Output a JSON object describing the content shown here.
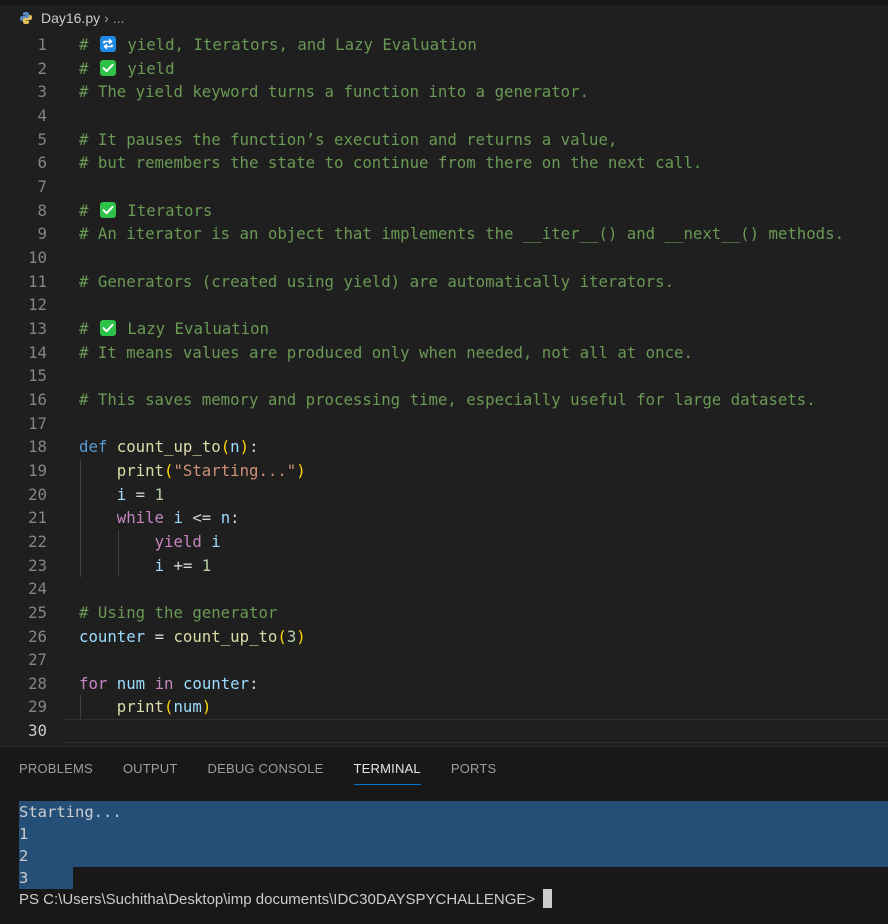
{
  "breadcrumb": {
    "file": "Day16.py",
    "separator": "›",
    "more": "..."
  },
  "editor": {
    "current_line": 30,
    "lines": [
      {
        "n": "1",
        "tokens": [
          [
            "cm",
            "# "
          ],
          [
            "emoji",
            "repeat"
          ],
          [
            "cm",
            " yield, Iterators, and Lazy Evaluation"
          ]
        ]
      },
      {
        "n": "2",
        "tokens": [
          [
            "cm",
            "# "
          ],
          [
            "emoji",
            "check"
          ],
          [
            "cm",
            " yield"
          ]
        ]
      },
      {
        "n": "3",
        "tokens": [
          [
            "cm",
            "# The yield keyword turns a function into a generator."
          ]
        ]
      },
      {
        "n": "4",
        "tokens": []
      },
      {
        "n": "5",
        "tokens": [
          [
            "cm",
            "# It pauses the function’s execution and returns a value,"
          ]
        ]
      },
      {
        "n": "6",
        "tokens": [
          [
            "cm",
            "# but remembers the state to continue from there on the next call."
          ]
        ]
      },
      {
        "n": "7",
        "tokens": []
      },
      {
        "n": "8",
        "tokens": [
          [
            "cm",
            "# "
          ],
          [
            "emoji",
            "check"
          ],
          [
            "cm",
            " Iterators"
          ]
        ]
      },
      {
        "n": "9",
        "tokens": [
          [
            "cm",
            "# An iterator is an object that implements the __iter__() and __next__() methods."
          ]
        ]
      },
      {
        "n": "10",
        "tokens": []
      },
      {
        "n": "11",
        "tokens": [
          [
            "cm",
            "# Generators (created using yield) are automatically iterators."
          ]
        ]
      },
      {
        "n": "12",
        "tokens": []
      },
      {
        "n": "13",
        "tokens": [
          [
            "cm",
            "# "
          ],
          [
            "emoji",
            "check"
          ],
          [
            "cm",
            " Lazy Evaluation"
          ]
        ]
      },
      {
        "n": "14",
        "tokens": [
          [
            "cm",
            "# It means values are produced only when needed, not all at once."
          ]
        ]
      },
      {
        "n": "15",
        "tokens": []
      },
      {
        "n": "16",
        "tokens": [
          [
            "cm",
            "# This saves memory and processing time, especially useful for large datasets."
          ]
        ]
      },
      {
        "n": "17",
        "tokens": []
      },
      {
        "n": "18",
        "tokens": [
          [
            "kw",
            "def"
          ],
          [
            "op",
            " "
          ],
          [
            "fn",
            "count_up_to"
          ],
          [
            "br1",
            "("
          ],
          [
            "var",
            "n"
          ],
          [
            "br1",
            ")"
          ],
          [
            "op",
            ":"
          ]
        ]
      },
      {
        "n": "19",
        "tokens": [
          [
            "op",
            "    "
          ],
          [
            "fn",
            "print"
          ],
          [
            "br1",
            "("
          ],
          [
            "str",
            "\"Starting...\""
          ],
          [
            "br1",
            ")"
          ]
        ]
      },
      {
        "n": "20",
        "tokens": [
          [
            "op",
            "    "
          ],
          [
            "var",
            "i"
          ],
          [
            "op",
            " = "
          ],
          [
            "num",
            "1"
          ]
        ]
      },
      {
        "n": "21",
        "tokens": [
          [
            "op",
            "    "
          ],
          [
            "ctl",
            "while"
          ],
          [
            "op",
            " "
          ],
          [
            "var",
            "i"
          ],
          [
            "op",
            " <= "
          ],
          [
            "var",
            "n"
          ],
          [
            "op",
            ":"
          ]
        ]
      },
      {
        "n": "22",
        "tokens": [
          [
            "op",
            "        "
          ],
          [
            "ctl",
            "yield"
          ],
          [
            "op",
            " "
          ],
          [
            "var",
            "i"
          ]
        ]
      },
      {
        "n": "23",
        "tokens": [
          [
            "op",
            "        "
          ],
          [
            "var",
            "i"
          ],
          [
            "op",
            " += "
          ],
          [
            "num",
            "1"
          ]
        ]
      },
      {
        "n": "24",
        "tokens": []
      },
      {
        "n": "25",
        "tokens": [
          [
            "cm",
            "# Using the generator"
          ]
        ]
      },
      {
        "n": "26",
        "tokens": [
          [
            "var",
            "counter"
          ],
          [
            "op",
            " = "
          ],
          [
            "fn",
            "count_up_to"
          ],
          [
            "br1",
            "("
          ],
          [
            "num",
            "3"
          ],
          [
            "br1",
            ")"
          ]
        ]
      },
      {
        "n": "27",
        "tokens": []
      },
      {
        "n": "28",
        "tokens": [
          [
            "ctl",
            "for"
          ],
          [
            "op",
            " "
          ],
          [
            "var",
            "num"
          ],
          [
            "op",
            " "
          ],
          [
            "ctl",
            "in"
          ],
          [
            "op",
            " "
          ],
          [
            "var",
            "counter"
          ],
          [
            "op",
            ":"
          ]
        ]
      },
      {
        "n": "29",
        "tokens": [
          [
            "op",
            "    "
          ],
          [
            "fn",
            "print"
          ],
          [
            "br1",
            "("
          ],
          [
            "var",
            "num"
          ],
          [
            "br1",
            ")"
          ]
        ]
      },
      {
        "n": "30",
        "tokens": []
      }
    ]
  },
  "panel": {
    "tabs": [
      {
        "label": "PROBLEMS",
        "active": false
      },
      {
        "label": "OUTPUT",
        "active": false
      },
      {
        "label": "DEBUG CONSOLE",
        "active": false
      },
      {
        "label": "TERMINAL",
        "active": true
      },
      {
        "label": "PORTS",
        "active": false
      }
    ],
    "terminal": {
      "output": [
        "Starting...",
        "1",
        "2",
        "3"
      ],
      "prompt": "PS C:\\Users\\Suchitha\\Desktop\\imp documents\\IDC30DAYSPYCHALLENGE>"
    }
  },
  "colors": {
    "editor_bg": "#1f1f1f",
    "panel_bg": "#181818",
    "selection": "#264f78",
    "accent": "#0078d4",
    "comment": "#6a9955",
    "keyword": "#569cd6",
    "control": "#c586c0",
    "function": "#dcdcaa",
    "variable": "#9cdcfe",
    "string": "#ce9178",
    "number": "#b5cea8"
  },
  "icons": {
    "file": "python-icon",
    "check": "check-mark-button-icon",
    "repeat": "repeat-button-icon"
  }
}
